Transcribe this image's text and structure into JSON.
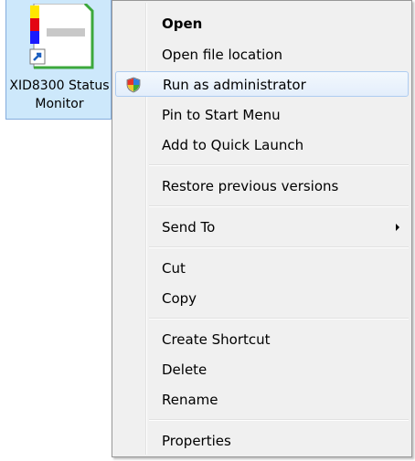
{
  "desktop_icon": {
    "caption_line1": "XID8300 Status",
    "caption_line2": "Monitor"
  },
  "context_menu": {
    "items": [
      {
        "label": "Open"
      },
      {
        "label": "Open file location"
      },
      {
        "label": "Run as administrator"
      },
      {
        "label": "Pin to Start Menu"
      },
      {
        "label": "Add to Quick Launch"
      },
      {
        "label": "Restore previous versions"
      },
      {
        "label": "Send To"
      },
      {
        "label": "Cut"
      },
      {
        "label": "Copy"
      },
      {
        "label": "Create Shortcut"
      },
      {
        "label": "Delete"
      },
      {
        "label": "Rename"
      },
      {
        "label": "Properties"
      }
    ]
  },
  "colors": {
    "selection": "#cde8fb",
    "menu_background": "#f0f0f0",
    "hover_border": "#aeccf1"
  }
}
